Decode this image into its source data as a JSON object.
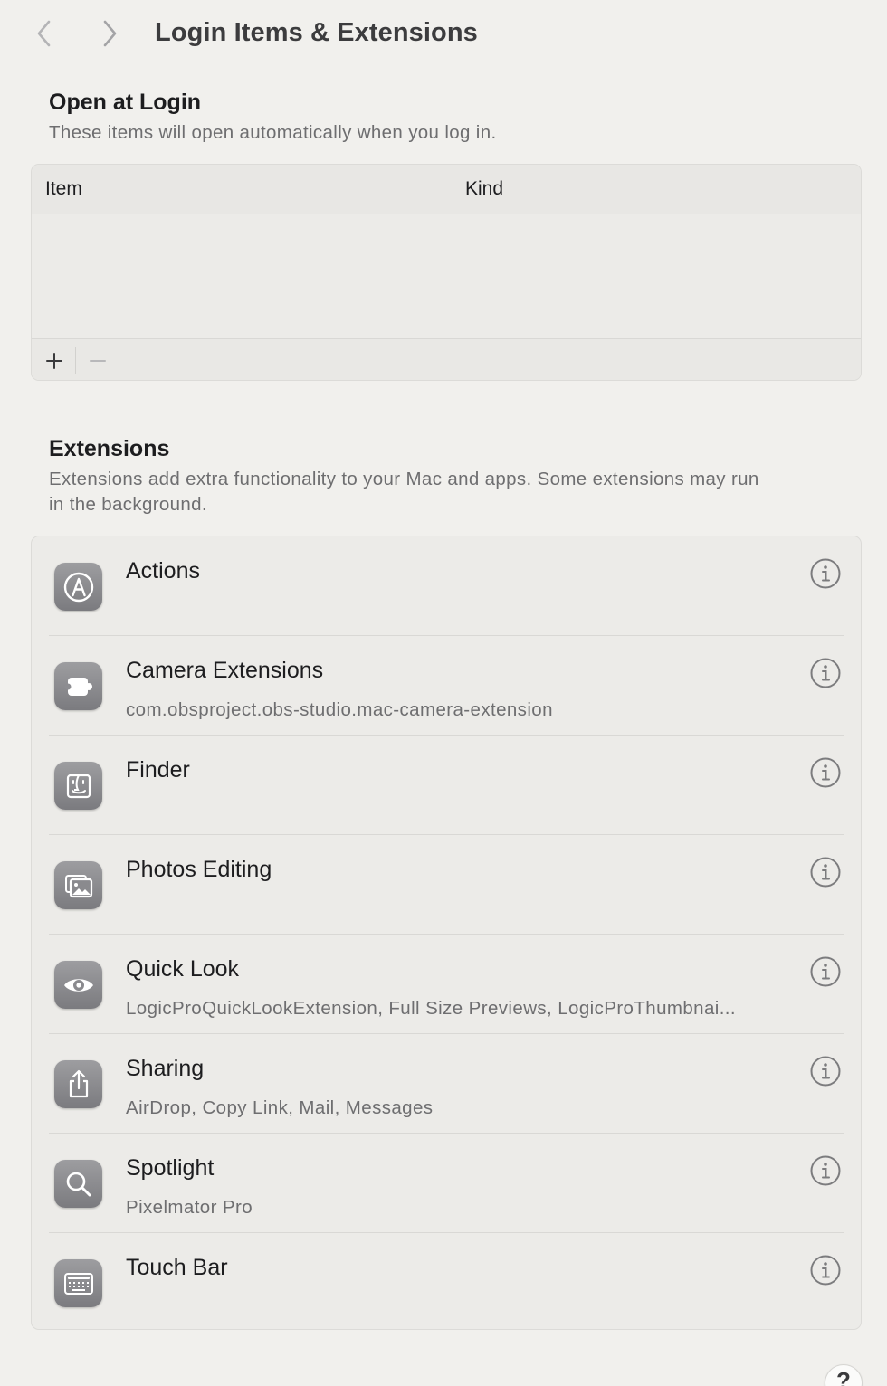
{
  "window": {
    "title": "Login Items & Extensions"
  },
  "open_at_login": {
    "title": "Open at Login",
    "description": "These items will open automatically when you log in.",
    "columns": [
      "Item",
      "Kind"
    ],
    "rows": [],
    "add_icon": "plus-icon",
    "remove_icon": "minus-icon"
  },
  "extensions": {
    "title": "Extensions",
    "description_line1": "Extensions add extra functionality to your Mac and apps. Some extensions may run",
    "description_line2": "in the background.",
    "items": [
      {
        "name": "Actions",
        "subtitle": "",
        "icon": "actions-icon"
      },
      {
        "name": "Camera Extensions",
        "subtitle": "com.obsproject.obs-studio.mac-camera-extension",
        "icon": "camera-extension-icon"
      },
      {
        "name": "Finder",
        "subtitle": "",
        "icon": "finder-icon"
      },
      {
        "name": "Photos Editing",
        "subtitle": "",
        "icon": "photos-icon"
      },
      {
        "name": "Quick Look",
        "subtitle": "LogicProQuickLookExtension, Full Size Previews, LogicProThumbnai...",
        "icon": "eye-icon"
      },
      {
        "name": "Sharing",
        "subtitle": "AirDrop, Copy Link, Mail, Messages",
        "icon": "share-icon"
      },
      {
        "name": "Spotlight",
        "subtitle": "Pixelmator Pro",
        "icon": "magnifier-icon"
      },
      {
        "name": "Touch Bar",
        "subtitle": "",
        "icon": "keyboard-icon"
      }
    ]
  },
  "help": {
    "label": "?"
  }
}
